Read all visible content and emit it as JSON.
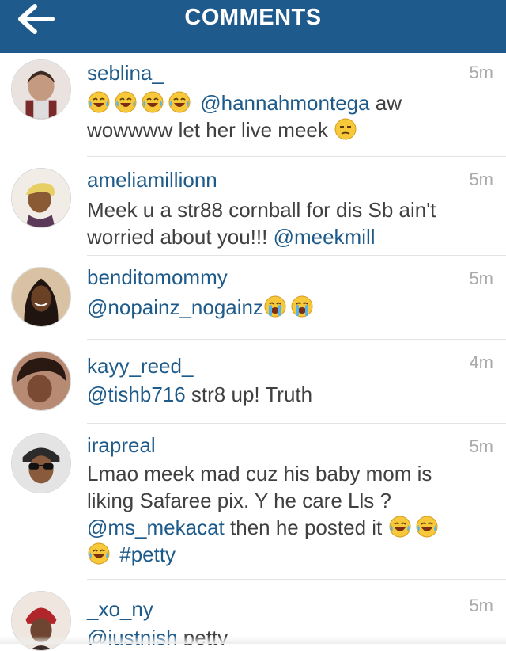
{
  "header": {
    "title": "COMMENTS",
    "background": "#1f5a8c"
  },
  "comments": [
    {
      "user": "seblina_",
      "time": "5m",
      "line1_prefix": "",
      "line1_mention": "@hannahmontega",
      "line1_suffix": " aw",
      "line2": "wowwww let her live meek"
    },
    {
      "user": "ameliamillionn",
      "time": "5m",
      "line1": "Meek u a str88 cornball for dis Sb ain't",
      "line2": "worried about you!!! ",
      "line2_mention": "@meekmill"
    },
    {
      "user": "benditomommy",
      "time": "5m",
      "mention": "@nopainz_nogainz"
    },
    {
      "user": "kayy_reed_",
      "time": "4m",
      "mention": "@tishb716",
      "text": " str8 up! Truth"
    },
    {
      "user": "irapreal",
      "time": "5m",
      "line1": "Lmao meek mad cuz his baby mom is",
      "line2": "liking  Safaree pix. Y he care Lls ?",
      "line3_mention": "@ms_mekacat",
      "line3_text": " then he posted it",
      "line4_hashtag": "#petty"
    },
    {
      "user": "_xo_ny",
      "time": "5m",
      "mention": "@justnish",
      "text": " petty"
    }
  ]
}
